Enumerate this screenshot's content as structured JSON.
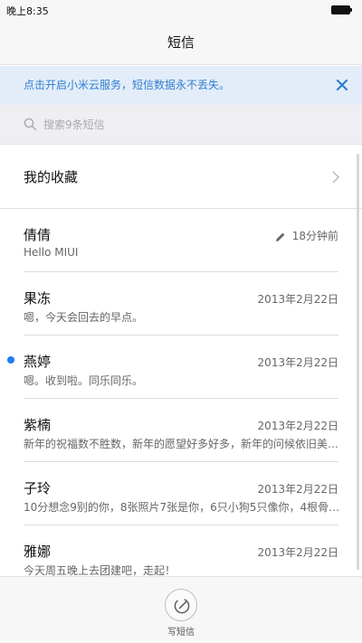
{
  "status_bar": {
    "time": "晚上8:35"
  },
  "header": {
    "title": "短信"
  },
  "banner": {
    "text": "点击开启小米云服务，短信数据永不丢失。",
    "accent": "#2f7ecf"
  },
  "search": {
    "placeholder": "搜索9条短信"
  },
  "favorites": {
    "label": "我的收藏"
  },
  "messages": [
    {
      "name": "倩倩",
      "preview": "Hello MIUI",
      "time": "18分钟前",
      "draft": true,
      "unread": false
    },
    {
      "name": "果冻",
      "preview": "嗯，今天会回去的早点。",
      "time": "2013年2月22日",
      "draft": false,
      "unread": false
    },
    {
      "name": "燕婷",
      "preview": "嗯。收到啦。同乐同乐。",
      "time": "2013年2月22日",
      "draft": false,
      "unread": true
    },
    {
      "name": "紫楠",
      "preview": "新年的祝福数不胜数，新年的愿望好多好多，新年的问候依旧美…",
      "time": "2013年2月22日",
      "draft": false,
      "unread": false
    },
    {
      "name": "子玲",
      "preview": "10分想念9别的你，8张照片7张是你，6只小狗5只像你，4根骨…",
      "time": "2013年2月22日",
      "draft": false,
      "unread": false
    },
    {
      "name": "雅娜",
      "preview": "今天周五晚上去团建吧，走起！",
      "time": "2013年2月22日",
      "draft": false,
      "unread": false
    }
  ],
  "bottom": {
    "compose_label": "写短信"
  },
  "colors": {
    "unread_dot": "#1e7cf2"
  }
}
